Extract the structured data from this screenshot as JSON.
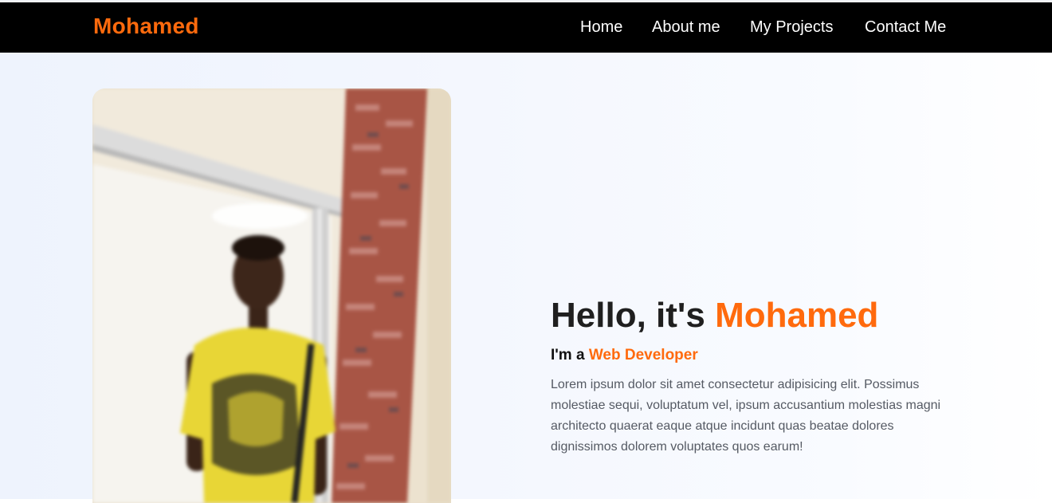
{
  "nav": {
    "brand": "Mohamed",
    "links": [
      {
        "label": "Home"
      },
      {
        "label": "About me"
      },
      {
        "label": "My Projects"
      },
      {
        "label": "Contact Me"
      }
    ]
  },
  "hero": {
    "greeting": "Hello, it's ",
    "name": "Mohamed",
    "role_prefix": "I'm a ",
    "role": "Web Developer",
    "description": "Lorem ipsum dolor sit amet consectetur adipisicing elit. Possimus molestiae sequi, voluptatum vel, ipsum accusantium molestias magni architecto quaerat eaque atque incidunt quas beatae dolores dignissimos dolorem voluptates quos earum!"
  },
  "colors": {
    "accent": "#ff6a0d",
    "navbar": "#000000",
    "heading": "#1f1f1f",
    "body_text": "#555a63"
  }
}
